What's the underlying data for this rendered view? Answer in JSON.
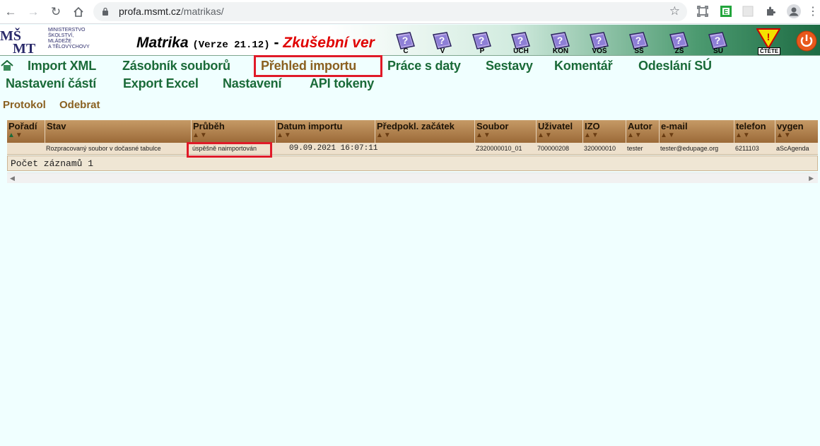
{
  "browser": {
    "url_host": "profa.msmt.cz",
    "url_path": "/matrikas/"
  },
  "header": {
    "logo_lines": [
      "MINISTERSTVO",
      "ŠKOLSTVÍ,",
      "MLÁDEŽE",
      "A TĚLOVÝCHOVY"
    ],
    "title": "Matrika",
    "version": "(Verze 21.12)",
    "dash": "-",
    "test_label": "Zkušební ver",
    "modules": [
      "C",
      "V",
      "P",
      "UCH",
      "KON",
      "VOŠ",
      "SŠ",
      "ZŠ",
      "SU"
    ],
    "ctete_label": "ČTĚTE"
  },
  "nav": {
    "row1": [
      "Import XML",
      "Zásobník souborů",
      "Přehled importu",
      "Práce s daty",
      "Sestavy",
      "Komentář",
      "Odeslání SÚ"
    ],
    "row2": [
      "Nastavení částí",
      "Export Excel",
      "Nastavení",
      "API tokeny"
    ],
    "active": "Přehled importu"
  },
  "subnav": [
    "Protokol",
    "Odebrat"
  ],
  "table": {
    "columns": [
      "Pořadí",
      "Stav",
      "Průběh",
      "Datum importu",
      "Předpokl. začátek",
      "Soubor",
      "Uživatel",
      "IZO",
      "Autor",
      "e-mail",
      "telefon",
      "vygen"
    ],
    "rows": [
      {
        "poradi": "",
        "stav": "Rozpracovaný soubor v dočasné tabulce",
        "prubeh": "úspěšně naimportován",
        "datum": "09.09.2021 16:07:11",
        "zacatek": "",
        "soubor": "Z320000010_01",
        "uzivatel": "700000208",
        "izo": "320000010",
        "autor": "tester",
        "email": "tester@edupage.org",
        "telefon": "6211103",
        "vygen": "aScAgenda"
      }
    ],
    "footer": "Počet záznamů 1"
  },
  "colors": {
    "nav_green": "#1a6a38",
    "nav_active_brown": "#8a6020",
    "highlight_red": "#e01a28",
    "page_bg": "#f0ffff"
  }
}
